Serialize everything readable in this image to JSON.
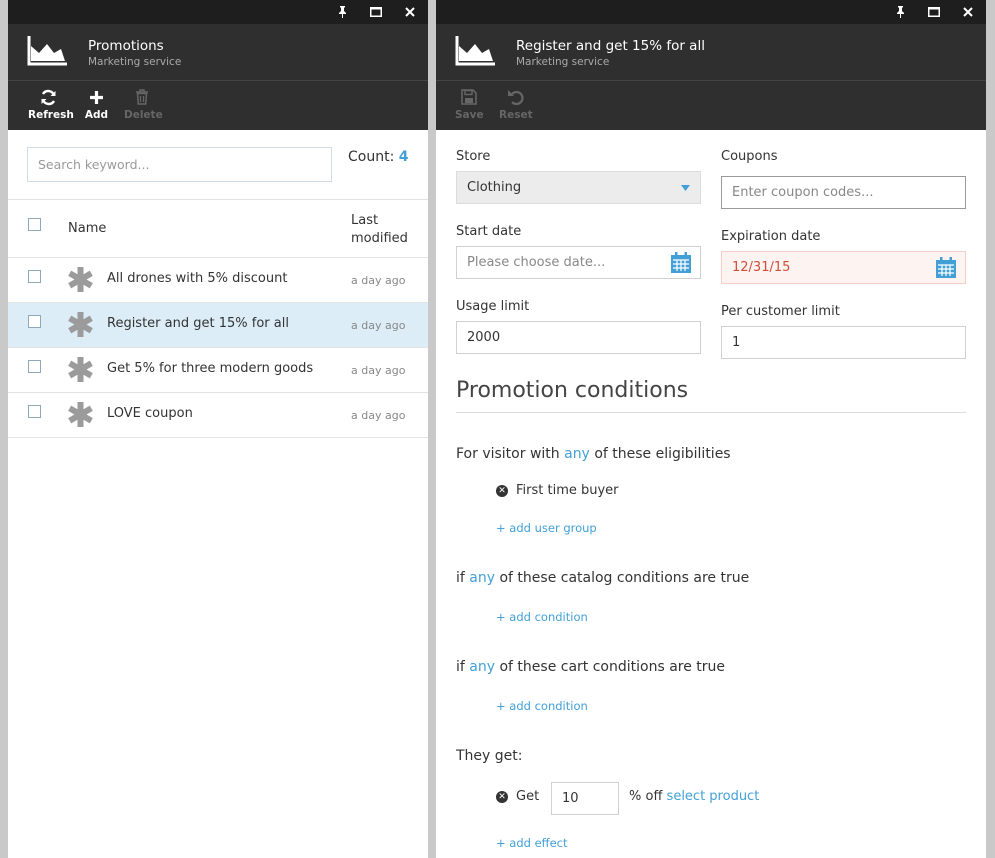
{
  "window_icons": {
    "pin": "pin-icon",
    "maximize": "maximize-icon",
    "close": "close-icon"
  },
  "colors": {
    "accent": "#43a0d6",
    "header_bg": "#2f2f2f",
    "titlebar_bg": "#1e1e1e",
    "selected_row": "#dcedf8"
  },
  "left": {
    "title": "Promotions",
    "subtitle": "Marketing service",
    "toolbar": {
      "refresh": "Refresh",
      "add": "Add",
      "delete": "Delete"
    },
    "search_placeholder": "Search keyword...",
    "count_label": "Count:",
    "count_value": "4",
    "columns": {
      "name": "Name",
      "modified": "Last modified"
    },
    "rows": [
      {
        "name": "All drones with 5% discount",
        "modified": "a day ago"
      },
      {
        "name": "Register and get 15% for all",
        "modified": "a day ago",
        "selected": true
      },
      {
        "name": "Get 5% for three modern goods",
        "modified": "a day ago"
      },
      {
        "name": "LOVE coupon",
        "modified": "a day ago"
      }
    ]
  },
  "right": {
    "title": "Register and get 15% for all",
    "subtitle": "Marketing service",
    "toolbar": {
      "save": "Save",
      "reset": "Reset"
    },
    "store_label": "Store",
    "store_value": "Clothing",
    "coupons_label": "Coupons",
    "coupons_placeholder": "Enter coupon codes...",
    "start_label": "Start date",
    "start_placeholder": "Please choose date...",
    "expiration_label": "Expiration date",
    "expiration_value": "12/31/15",
    "usage_label": "Usage limit",
    "usage_value": "2000",
    "per_customer_label": "Per customer limit",
    "per_customer_value": "1",
    "conditions_heading": "Promotion conditions",
    "visitor_prefix": "For visitor with",
    "visitor_kw": "any",
    "visitor_suffix": "of these eligibilities",
    "eligibility_chip": "First time buyer",
    "add_user_group": "+ add user group",
    "catalog_prefix": "if",
    "catalog_kw": "any",
    "catalog_suffix": "of these catalog conditions are true",
    "add_condition_catalog": "+ add condition",
    "cart_prefix": "if",
    "cart_kw": "any",
    "cart_suffix": "of these cart conditions are true",
    "add_condition_cart": "+ add condition",
    "they_get": "They get:",
    "get_label": "Get",
    "get_value": "10",
    "percent_off": "% off",
    "select_product": "select product",
    "add_effect": "+ add effect"
  }
}
